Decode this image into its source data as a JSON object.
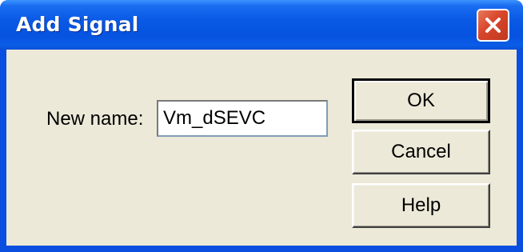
{
  "window": {
    "title": "Add Signal",
    "close_icon": "close-x-icon"
  },
  "form": {
    "name_label": "New name:",
    "name_value": "Vm_dSEVC"
  },
  "buttons": {
    "ok": "OK",
    "cancel": "Cancel",
    "help": "Help"
  },
  "colors": {
    "title_bar": "#0A5AE6",
    "close_button": "#D7452A",
    "dialog_background": "#ECE9D8"
  }
}
